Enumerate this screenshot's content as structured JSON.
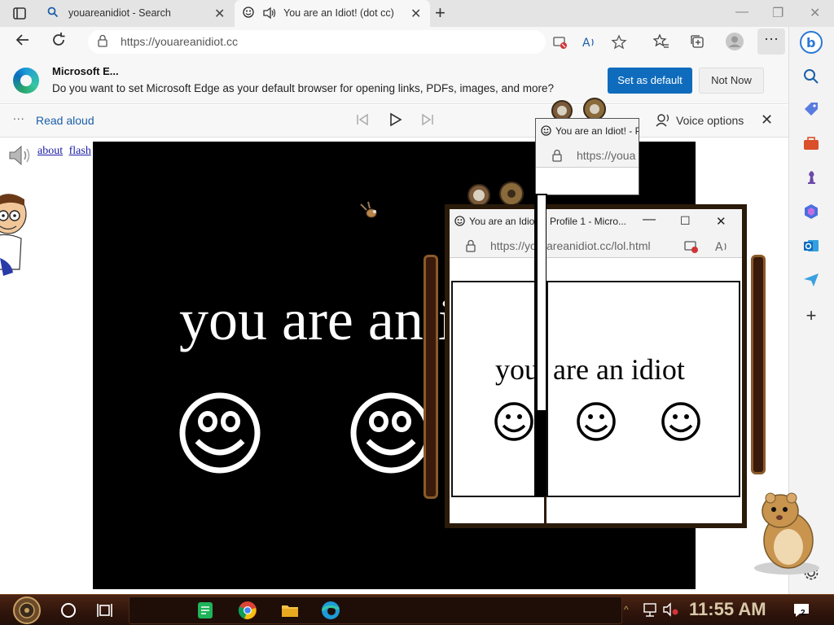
{
  "tabs": [
    {
      "title": "youareanidiot - Search",
      "active": false,
      "icon": "search-icon"
    },
    {
      "title": "You are an Idiot! (dot cc)",
      "active": true,
      "icon": "smiley-favicon-icon"
    }
  ],
  "address_bar": {
    "url": "https://youareanidiot.cc"
  },
  "infobar": {
    "title": "Microsoft E...",
    "message": "Do you want to set Microsoft Edge as your default browser for opening links, PDFs, images, and more?",
    "primary_button": "Set as default",
    "secondary_button": "Not Now"
  },
  "read_aloud": {
    "label": "Read aloud",
    "voice_options": "Voice options"
  },
  "page": {
    "links": [
      "about",
      "flash"
    ],
    "main_text": "you are an idiot"
  },
  "popups": [
    {
      "title": "You are an Idiot! - P",
      "url": "https://youa"
    },
    {
      "title": "You are an Idiot",
      "url": "https://yo"
    },
    {
      "title": "Profile 1 - Micro...",
      "url": "areanidiot.cc/lol.html",
      "text": "are an idiot"
    }
  ],
  "popup_text_fragment": "you",
  "taskbar": {
    "time": "11:55 AM",
    "notification_count": "2"
  },
  "colors": {
    "accent": "#0f6cbd",
    "stage_bg": "#000000",
    "taskbar": "#2e140b"
  }
}
